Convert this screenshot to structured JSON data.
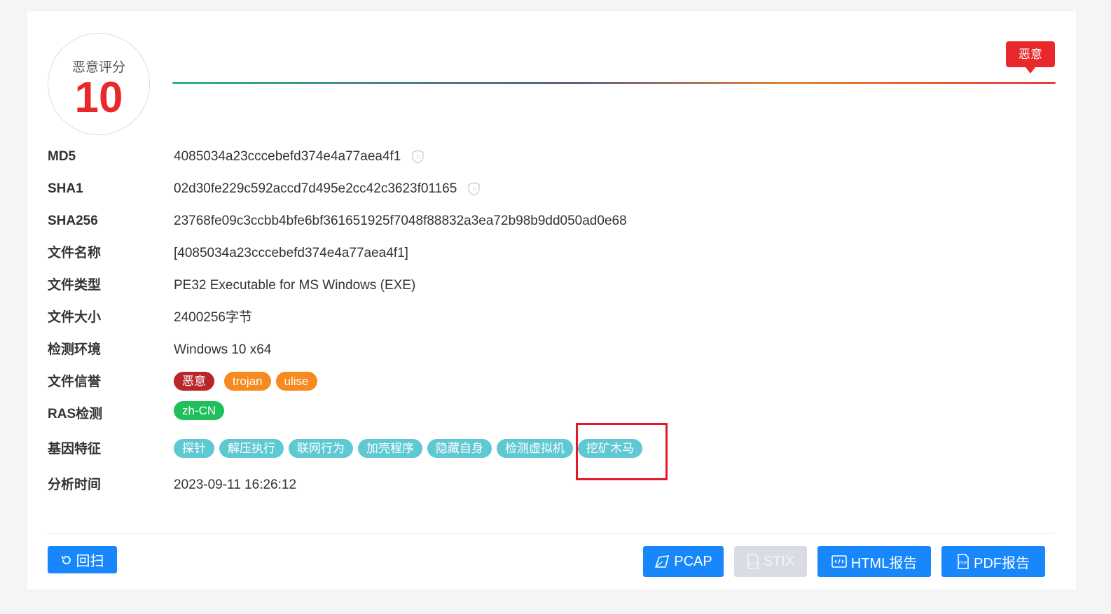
{
  "score": {
    "label": "恶意评分",
    "value": "10",
    "level": 1.0
  },
  "verdict": {
    "label": "恶意",
    "color": "#e8282b"
  },
  "fields": {
    "md5": {
      "key": "MD5",
      "value": "4085034a23cccebefd374e4a77aea4f1"
    },
    "sha1": {
      "key": "SHA1",
      "value": "02d30fe229c592accd7d495e2cc42c3623f01165"
    },
    "sha256": {
      "key": "SHA256",
      "value": "23768fe09c3ccbb4bfe6bf361651925f7048f88832a3ea72b98b9dd050ad0e68"
    },
    "filename": {
      "key": "文件名称",
      "value": "[4085034a23cccebefd374e4a77aea4f1]"
    },
    "filetype": {
      "key": "文件类型",
      "value": "PE32 Executable for MS Windows (EXE)"
    },
    "filesize": {
      "key": "文件大小",
      "value": "2400256字节"
    },
    "env": {
      "key": "检测环境",
      "value": "Windows 10 x64"
    },
    "reputation": {
      "key": "文件信誉",
      "tags": [
        "恶意",
        "trojan",
        "ulise"
      ]
    },
    "ras": {
      "key": "RAS检测",
      "tags": [
        "zh-CN"
      ]
    },
    "genes": {
      "key": "基因特征",
      "tags": [
        "探针",
        "解压执行",
        "联网行为",
        "加壳程序",
        "隐藏自身",
        "检测虚拟机",
        "挖矿木马"
      ]
    },
    "time": {
      "key": "分析时间",
      "value": "2023-09-11 16:26:12"
    }
  },
  "buttons": {
    "rescan": "回扫",
    "pcap": "PCAP",
    "stix": "STIX",
    "html_report": "HTML报告",
    "pdf_report": "PDF报告"
  },
  "icons": {
    "ti": "ti-shield-icon",
    "rescan": "refresh-icon",
    "pcap": "pcap-icon",
    "stix": "stix-file-icon",
    "html": "html-file-icon",
    "pdf": "pdf-file-icon"
  },
  "colors": {
    "primary": "#1787fb",
    "malicious": "#e8282b",
    "tag_red": "#b8262a",
    "tag_orange": "#f6891f",
    "tag_green": "#1fbf5a",
    "tag_cyan": "#5ec8d3"
  }
}
